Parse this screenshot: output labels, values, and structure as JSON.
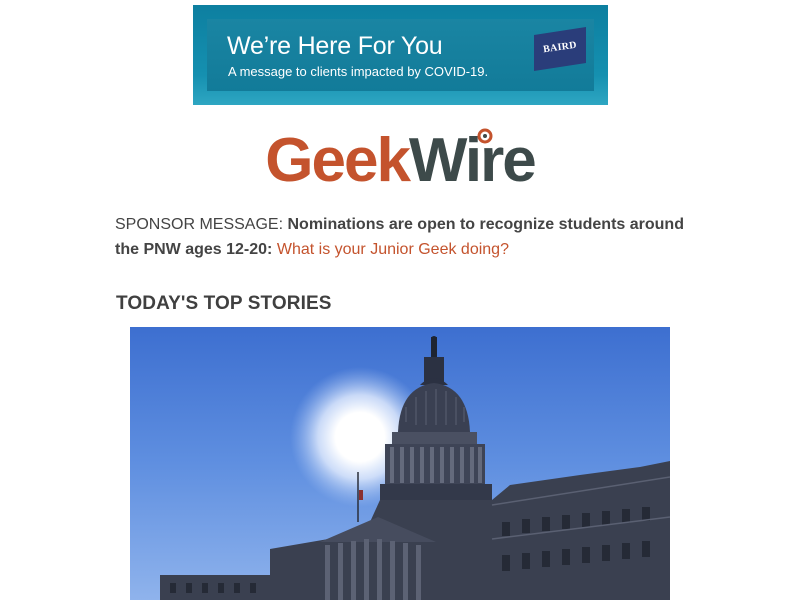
{
  "banner": {
    "title": "We’re Here For You",
    "subtitle": "A message to clients impacted by COVID-19.",
    "brand": "BAIRD",
    "colors": {
      "background": "#1590b0",
      "brand_badge": "#2a3d7a"
    }
  },
  "logo": {
    "part1": "Geek",
    "part2": "Wire",
    "colors": {
      "part1": "#c4532d",
      "part2": "#3d4a4a"
    }
  },
  "sponsor": {
    "prefix": "SPONSOR MESSAGE: ",
    "bold_text": "Nominations are open to recognize students around the PNW ages 12-20:",
    "link_text": "What is your Junior Geek doing?",
    "colors": {
      "link": "#c4532d"
    }
  },
  "section": {
    "heading": "TODAY'S TOP STORIES"
  },
  "story": {
    "image_icon": "us-capitol-photo"
  }
}
